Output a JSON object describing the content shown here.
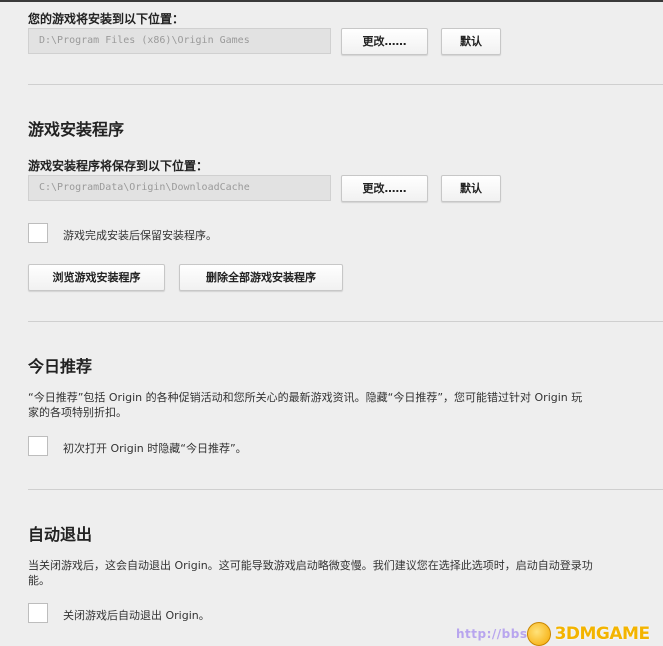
{
  "install_location": {
    "label": "您的游戏将安装到以下位置：",
    "path": "D:\\Program Files (x86)\\Origin Games",
    "change_label": "更改……",
    "default_label": "默认"
  },
  "installer": {
    "title": "游戏安装程序",
    "label": "游戏安装程序将保存到以下位置：",
    "path": "C:\\ProgramData\\Origin\\DownloadCache",
    "change_label": "更改……",
    "default_label": "默认",
    "keep_checkbox_label": "游戏完成安装后保留安装程序。",
    "browse_label": "浏览游戏安装程序",
    "delete_all_label": "删除全部游戏安装程序"
  },
  "today": {
    "title": "今日推荐",
    "description_line1": "“今日推荐”包括 Origin 的各种促销活动和您所关心的最新游戏资讯。隐藏“今日推荐”，您可能错过针对 Origin 玩",
    "description_line2": "家的各项特别折扣。",
    "checkbox_label": "初次打开 Origin 时隐藏“今日推荐”。"
  },
  "auto_exit": {
    "title": "自动退出",
    "description_line1": "当关闭游戏后，这会自动退出 Origin。这可能导致游戏启动略微变慢。我们建议您在选择此选项时，启动自动登录功",
    "description_line2": "能。",
    "checkbox_label": "关闭游戏后自动退出 Origin。"
  },
  "watermark": {
    "url": "http://bbs.",
    "brand": "3DMGAME"
  }
}
